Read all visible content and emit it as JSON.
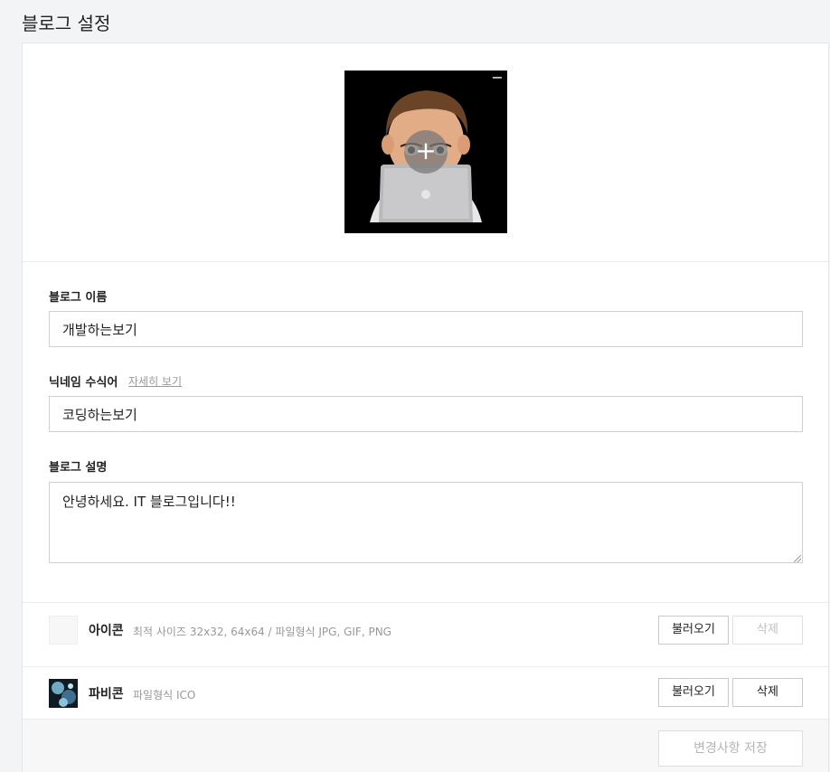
{
  "page": {
    "title": "블로그 설정"
  },
  "profile": {
    "remove_glyph": "−",
    "add_glyph": "+"
  },
  "fields": {
    "blog_name": {
      "label": "블로그 이름",
      "value": "개발하는보기"
    },
    "nickname_modifier": {
      "label": "닉네임 수식어",
      "link": "자세히 보기",
      "value": "코딩하는보기"
    },
    "description": {
      "label": "블로그 설명",
      "value": "안녕하세요. IT 블로그입니다!!"
    }
  },
  "icon_row": {
    "title": "아이콘",
    "desc": "최적 사이즈 32x32, 64x64 / 파일형식 JPG, GIF, PNG",
    "load_label": "불러오기",
    "delete_label": "삭제"
  },
  "favicon_row": {
    "title": "파비콘",
    "desc": "파일형식 ICO",
    "load_label": "불러오기",
    "delete_label": "삭제"
  },
  "footer": {
    "save_label": "변경사항 저장"
  },
  "colors": {
    "background": "#f3f4f6",
    "border": "#d0d0d0",
    "muted": "#999999"
  },
  "icons": [
    "minus-icon",
    "plus-icon",
    "avatar-image",
    "favicon-image"
  ]
}
